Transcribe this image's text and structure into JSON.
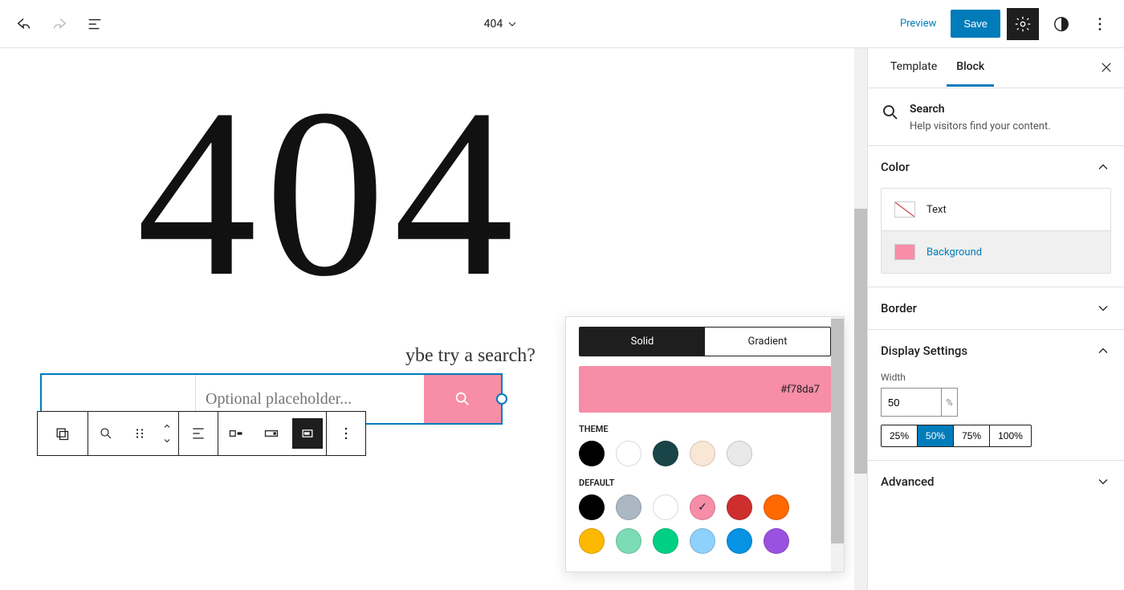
{
  "topbar": {
    "doc_title": "404",
    "preview": "Preview",
    "save": "Save"
  },
  "canvas": {
    "big_text": "404",
    "hint": "ybe try a search?",
    "search_placeholder": "Optional placeholder..."
  },
  "color_popover": {
    "tabs": {
      "solid": "Solid",
      "gradient": "Gradient"
    },
    "hex": "#f78da7",
    "section_theme": "THEME",
    "section_default": "DEFAULT",
    "theme_colors": [
      "#000000",
      "#ffffff",
      "#1a4548",
      "#f9e7d5",
      "#e9e9e9"
    ],
    "default_colors_row1": [
      "#000000",
      "#abb8c3",
      "#ffffff",
      "#f78da7",
      "#cf2e2e",
      "#ff6900"
    ],
    "default_colors_row2": [
      "#fcb900",
      "#7bdcb5",
      "#00d084",
      "#8ed1fc",
      "#0693e3",
      "#9b51e0"
    ],
    "selected": "#f78da7"
  },
  "sidebar": {
    "tabs": {
      "template": "Template",
      "block": "Block"
    },
    "block_title": "Search",
    "block_desc": "Help visitors find your content.",
    "panels": {
      "color": "Color",
      "border": "Border",
      "display": "Display Settings",
      "advanced": "Advanced"
    },
    "color_text": "Text",
    "color_bg": "Background",
    "width_label": "Width",
    "width_value": "50",
    "width_unit": "%",
    "presets": [
      "25%",
      "50%",
      "75%",
      "100%"
    ],
    "active_preset": "50%"
  }
}
